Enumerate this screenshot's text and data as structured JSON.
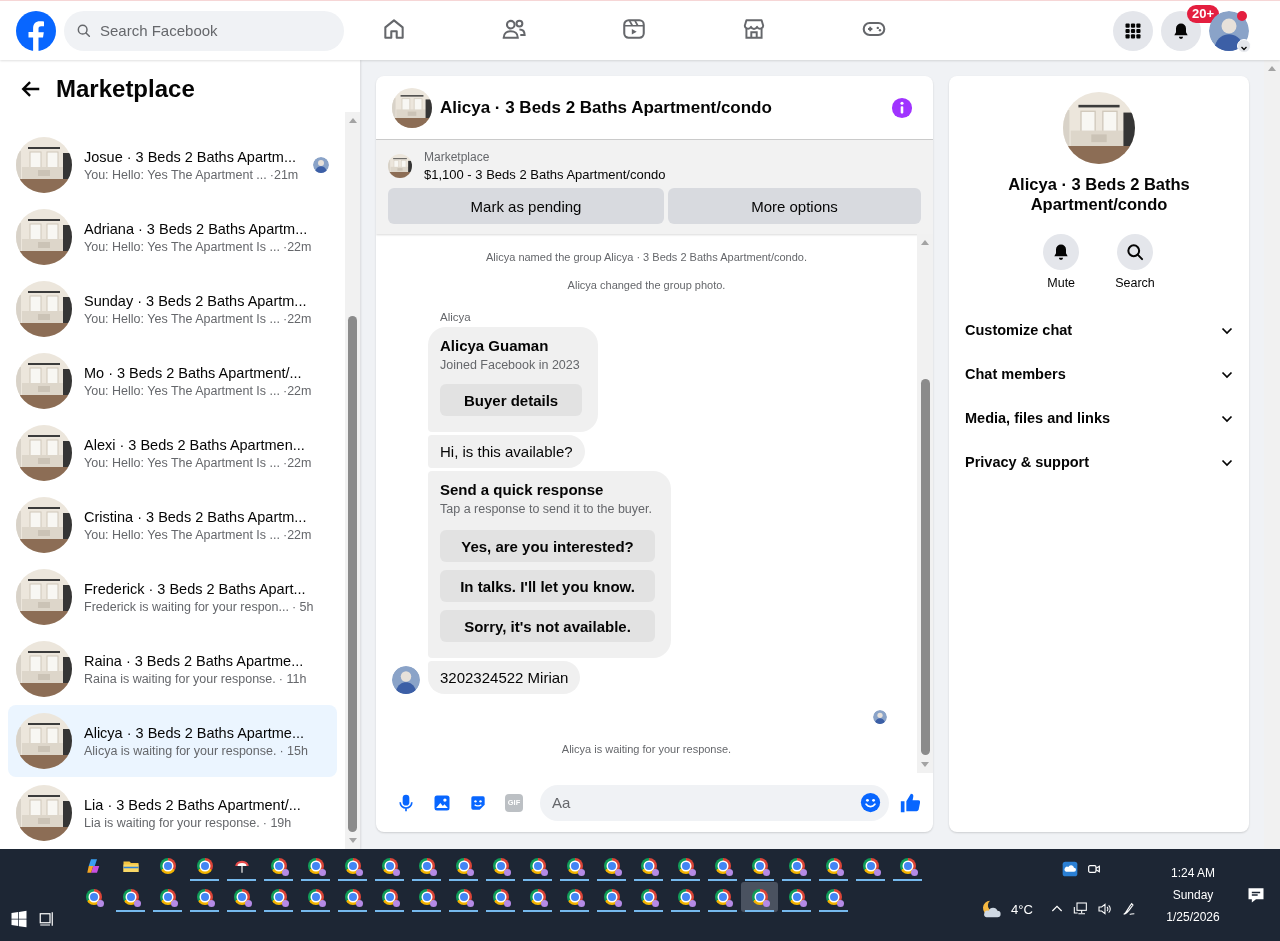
{
  "top_bar": {
    "search": {
      "placeholder": "Search Facebook"
    },
    "nav": [
      {
        "kind": "home",
        "selected": false
      },
      {
        "kind": "friends",
        "selected": false
      },
      {
        "kind": "video",
        "selected": false
      },
      {
        "kind": "marketplace",
        "selected": false
      },
      {
        "kind": "gaming",
        "selected": false
      }
    ],
    "notifications_badge": "20+",
    "profile": {
      "status_dot": true
    }
  },
  "sidebar": {
    "title": "Marketplace",
    "conversations": [
      {
        "name": "Josue · 3 Beds 2 Baths Apartm...",
        "preview": "You: Hello: Yes The Apartment ...",
        "time": "·21m",
        "seen_avatar": true,
        "selected": false
      },
      {
        "name": "Adriana · 3 Beds 2 Baths Apartm...",
        "preview": "You: Hello: Yes The Apartment Is ...",
        "time": "·22m",
        "seen_avatar": false,
        "selected": false
      },
      {
        "name": "Sunday · 3 Beds 2 Baths Apartm...",
        "preview": "You: Hello: Yes The Apartment Is ...",
        "time": "·22m",
        "seen_avatar": false,
        "selected": false
      },
      {
        "name": "Mo · 3 Beds 2 Baths Apartment/...",
        "preview": "You: Hello: Yes The Apartment Is ...",
        "time": "·22m",
        "seen_avatar": false,
        "selected": false
      },
      {
        "name": "Alexi · 3 Beds 2 Baths Apartmen...",
        "preview": "You: Hello: Yes The Apartment Is ...",
        "time": "·22m",
        "seen_avatar": false,
        "selected": false
      },
      {
        "name": "Cristina · 3 Beds 2 Baths Apartm...",
        "preview": "You: Hello: Yes The Apartment Is ...",
        "time": "·22m",
        "seen_avatar": false,
        "selected": false
      },
      {
        "name": "Frederick · 3 Beds 2 Baths Apart...",
        "preview": "Frederick is waiting for your respon...",
        "time": "· 5h",
        "seen_avatar": false,
        "selected": false
      },
      {
        "name": "Raina · 3 Beds 2 Baths Apartme...",
        "preview": "Raina is waiting for your response.",
        "time": "· 11h",
        "seen_avatar": false,
        "selected": false
      },
      {
        "name": "Alicya · 3 Beds 2 Baths Apartme...",
        "preview": "Alicya is waiting for your response.",
        "time": "· 15h",
        "seen_avatar": false,
        "selected": true
      },
      {
        "name": "Lia · 3 Beds 2 Baths Apartment/...",
        "preview": "Lia is waiting for your response.",
        "time": "· 19h",
        "seen_avatar": false,
        "selected": false
      }
    ]
  },
  "chat": {
    "title": "Alicya · 3 Beds 2 Baths Apartment/condo",
    "listing": {
      "label": "Marketplace",
      "title": "$1,100 - 3 Beds 2 Baths Apartment/condo",
      "buttons": [
        "Mark as pending",
        "More options"
      ]
    },
    "messages": [
      {
        "kind": "system",
        "text": "Alicya named the group Alicya · 3 Beds 2 Baths Apartment/condo."
      },
      {
        "kind": "system",
        "text": "Alicya changed the group photo."
      },
      {
        "kind": "sender",
        "text": "Alicya"
      },
      {
        "kind": "buyer_card",
        "title": "Alicya Guaman",
        "subtitle": "Joined Facebook in 2023",
        "button": "Buyer details"
      },
      {
        "kind": "bubble",
        "text": "Hi, is this available?",
        "avatar": false
      },
      {
        "kind": "quick_replies",
        "title": "Send a quick response",
        "subtitle": "Tap a response to send it to the buyer.",
        "options": [
          "Yes, are you interested?",
          "In talks. I'll let you know.",
          "Sorry, it's not available."
        ]
      },
      {
        "kind": "bubble",
        "text": "3202324522 Mirian",
        "avatar": true
      },
      {
        "kind": "seen_marker"
      },
      {
        "kind": "status",
        "text": "Alicya is waiting for your response."
      }
    ],
    "composer": {
      "placeholder": "Aa",
      "gif_label": "GIF"
    }
  },
  "info_panel": {
    "title": "Alicya · 3 Beds 2 Baths Apartment/condo",
    "actions": [
      {
        "kind": "mute",
        "label": "Mute"
      },
      {
        "kind": "search",
        "label": "Search"
      }
    ],
    "sections": [
      {
        "label": "Customize chat",
        "expanded": false
      },
      {
        "label": "Chat members",
        "expanded": false
      },
      {
        "label": "Media, files and links",
        "expanded": false
      },
      {
        "label": "Privacy & support",
        "expanded": false
      }
    ]
  },
  "taskbar": {
    "row_1": [
      {
        "kind": "copilot",
        "open": false,
        "selected": false
      },
      {
        "kind": "explorer",
        "open": false,
        "selected": false
      },
      {
        "kind": "chrome",
        "open": false,
        "selected": false
      },
      {
        "kind": "chrome",
        "open": true,
        "selected": false
      },
      {
        "kind": "app",
        "open": true,
        "selected": false
      },
      {
        "kind": "chrome_profile",
        "open": true,
        "selected": false
      },
      {
        "kind": "chrome_profile",
        "open": true,
        "selected": false
      },
      {
        "kind": "chrome_profile",
        "open": true,
        "selected": false
      },
      {
        "kind": "chrome_profile",
        "open": true,
        "selected": false
      },
      {
        "kind": "chrome_profile",
        "open": true,
        "selected": false
      },
      {
        "kind": "chrome_profile",
        "open": true,
        "selected": false
      },
      {
        "kind": "chrome_profile",
        "open": true,
        "selected": false
      },
      {
        "kind": "chrome_profile",
        "open": true,
        "selected": false
      },
      {
        "kind": "chrome_profile",
        "open": true,
        "selected": false
      },
      {
        "kind": "chrome_profile",
        "open": true,
        "selected": false
      },
      {
        "kind": "chrome_profile",
        "open": true,
        "selected": false
      },
      {
        "kind": "chrome_profile",
        "open": true,
        "selected": false
      },
      {
        "kind": "chrome_profile",
        "open": true,
        "selected": false
      },
      {
        "kind": "chrome_profile",
        "open": true,
        "selected": false
      },
      {
        "kind": "chrome_profile",
        "open": true,
        "selected": false
      },
      {
        "kind": "chrome_profile",
        "open": true,
        "selected": false
      },
      {
        "kind": "chrome_profile",
        "open": true,
        "selected": false
      },
      {
        "kind": "chrome_profile",
        "open": true,
        "selected": false
      }
    ],
    "row_2": [
      {
        "kind": "chrome_profile",
        "open": false,
        "selected": false
      },
      {
        "kind": "chrome_profile",
        "open": true,
        "selected": false
      },
      {
        "kind": "chrome_profile",
        "open": true,
        "selected": false
      },
      {
        "kind": "chrome_profile",
        "open": true,
        "selected": false
      },
      {
        "kind": "chrome_profile",
        "open": true,
        "selected": false
      },
      {
        "kind": "chrome_profile",
        "open": true,
        "selected": false
      },
      {
        "kind": "chrome_profile",
        "open": true,
        "selected": false
      },
      {
        "kind": "chrome_profile",
        "open": true,
        "selected": false
      },
      {
        "kind": "chrome_profile",
        "open": true,
        "selected": false
      },
      {
        "kind": "chrome_profile",
        "open": true,
        "selected": false
      },
      {
        "kind": "chrome_profile",
        "open": true,
        "selected": false
      },
      {
        "kind": "chrome_profile",
        "open": true,
        "selected": false
      },
      {
        "kind": "chrome_profile",
        "open": true,
        "selected": false
      },
      {
        "kind": "chrome_profile",
        "open": true,
        "selected": false
      },
      {
        "kind": "chrome_profile",
        "open": true,
        "selected": false
      },
      {
        "kind": "chrome_profile",
        "open": true,
        "selected": false
      },
      {
        "kind": "chrome_profile",
        "open": true,
        "selected": false
      },
      {
        "kind": "chrome_profile",
        "open": true,
        "selected": false
      },
      {
        "kind": "chrome_profile",
        "open": true,
        "selected": true
      },
      {
        "kind": "chrome_profile",
        "open": true,
        "selected": false
      },
      {
        "kind": "chrome_profile",
        "open": true,
        "selected": false
      }
    ],
    "temperature": "4°C",
    "time": "1:24 AM",
    "day": "Sunday",
    "date": "1/25/2026"
  }
}
